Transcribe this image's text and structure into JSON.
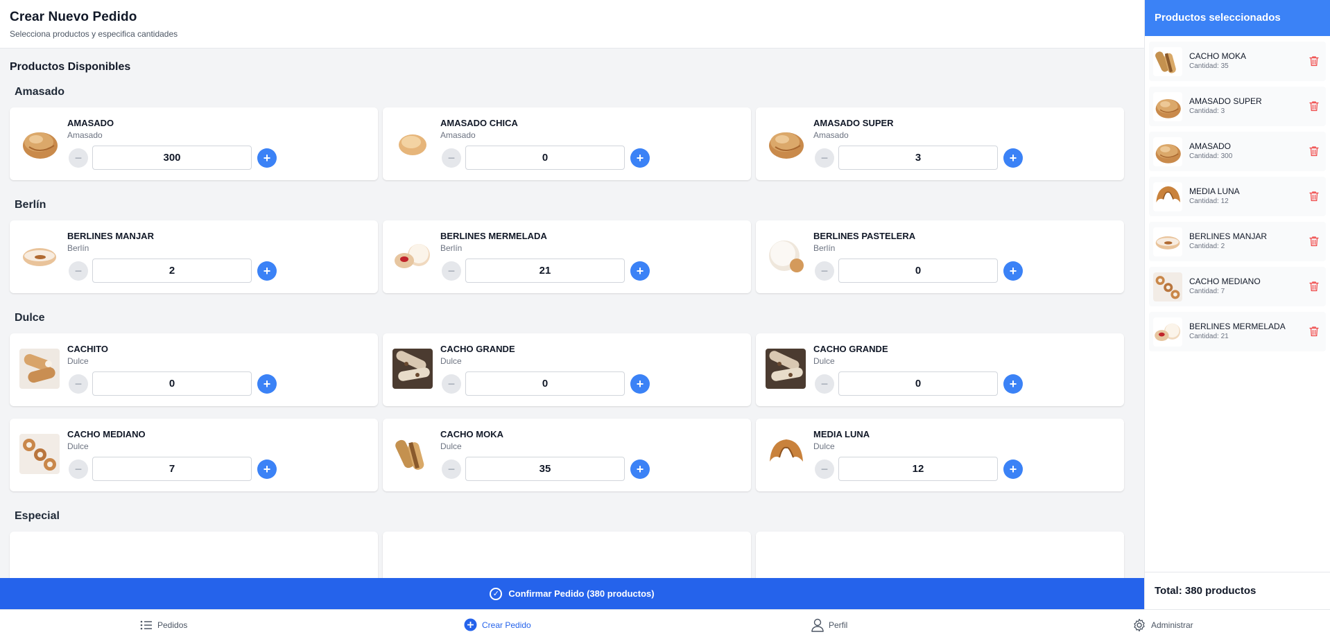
{
  "header": {
    "title": "Crear Nuevo Pedido",
    "subtitle": "Selecciona productos y especifica cantidades"
  },
  "content": {
    "section_title": "Productos Disponibles",
    "categories": [
      {
        "title": "Amasado",
        "products": [
          {
            "name": "AMASADO",
            "category": "Amasado",
            "quantity": "300",
            "image": "bread-roll"
          },
          {
            "name": "AMASADO CHICA",
            "category": "Amasado",
            "quantity": "0",
            "image": "small-bun"
          },
          {
            "name": "AMASADO SUPER",
            "category": "Amasado",
            "quantity": "3",
            "image": "bread-roll"
          }
        ]
      },
      {
        "title": "Berlín",
        "products": [
          {
            "name": "BERLINES MANJAR",
            "category": "Berlín",
            "quantity": "2",
            "image": "berlin-manjar"
          },
          {
            "name": "BERLINES MERMELADA",
            "category": "Berlín",
            "quantity": "21",
            "image": "berlin-jam"
          },
          {
            "name": "BERLINES PASTELERA",
            "category": "Berlín",
            "quantity": "0",
            "image": "berlin-sugar"
          }
        ]
      },
      {
        "title": "Dulce",
        "products": [
          {
            "name": "CACHITO",
            "category": "Dulce",
            "quantity": "0",
            "image": "cachito"
          },
          {
            "name": "CACHO GRANDE",
            "category": "Dulce",
            "quantity": "0",
            "image": "cacho-grande"
          },
          {
            "name": "CACHO GRANDE",
            "category": "Dulce",
            "quantity": "0",
            "image": "cacho-grande"
          },
          {
            "name": "CACHO MEDIANO",
            "category": "Dulce",
            "quantity": "7",
            "image": "cacho-mediano"
          },
          {
            "name": "CACHO MOKA",
            "category": "Dulce",
            "quantity": "35",
            "image": "cacho-moka"
          },
          {
            "name": "MEDIA LUNA",
            "category": "Dulce",
            "quantity": "12",
            "image": "croissant"
          }
        ]
      },
      {
        "title": "Especial",
        "products": []
      }
    ]
  },
  "confirm_button": {
    "label": "Confirmar Pedido (380 productos)"
  },
  "selected_panel": {
    "title": "Productos seleccionados",
    "items": [
      {
        "name": "CACHO MOKA",
        "quantity_text": "Cantidad: 35",
        "image": "cacho-moka"
      },
      {
        "name": "AMASADO SUPER",
        "quantity_text": "Cantidad: 3",
        "image": "bread-roll"
      },
      {
        "name": "AMASADO",
        "quantity_text": "Cantidad: 300",
        "image": "bread-roll"
      },
      {
        "name": "MEDIA LUNA",
        "quantity_text": "Cantidad: 12",
        "image": "croissant"
      },
      {
        "name": "BERLINES MANJAR",
        "quantity_text": "Cantidad: 2",
        "image": "berlin-manjar"
      },
      {
        "name": "CACHO MEDIANO",
        "quantity_text": "Cantidad: 7",
        "image": "cacho-mediano"
      },
      {
        "name": "BERLINES MERMELADA",
        "quantity_text": "Cantidad: 21",
        "image": "berlin-jam"
      }
    ],
    "total": "Total: 380 productos"
  },
  "bottom_nav": [
    {
      "label": "Pedidos",
      "icon": "list-icon",
      "active": false
    },
    {
      "label": "Crear Pedido",
      "icon": "plus-circle-icon",
      "active": true
    },
    {
      "label": "Perfil",
      "icon": "user-icon",
      "active": false
    },
    {
      "label": "Administrar",
      "icon": "gear-icon",
      "active": false
    }
  ],
  "colors": {
    "primary": "#3b82f6",
    "primary_dark": "#2563eb",
    "delete": "#ef4444",
    "background": "#f3f4f6"
  }
}
